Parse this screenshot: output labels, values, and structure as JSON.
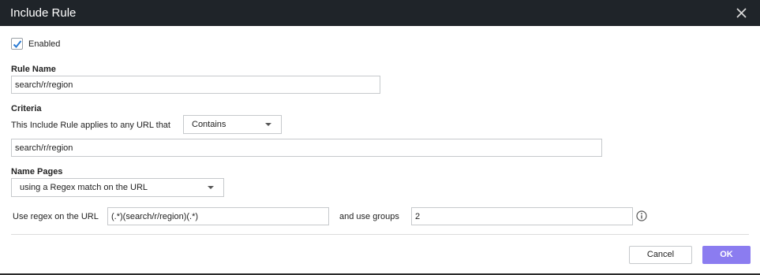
{
  "dialog": {
    "title": "Include Rule",
    "close_icon": "close-icon"
  },
  "enabled": {
    "checked": true,
    "label": "Enabled"
  },
  "rule_name": {
    "label": "Rule Name",
    "value": "search/r/region"
  },
  "criteria": {
    "label": "Criteria",
    "applies_text": "This Include Rule applies to any URL that",
    "match_type": "Contains",
    "value": "search/r/region"
  },
  "name_pages": {
    "label": "Name Pages",
    "method": "using a Regex match on the URL",
    "regex_label": "Use regex on the URL",
    "regex_value": "(.*)(search/r/region)(.*)",
    "groups_label": "and use groups",
    "groups_value": "2",
    "info_icon": "info-icon"
  },
  "buttons": {
    "cancel": "Cancel",
    "ok": "OK"
  },
  "colors": {
    "titlebar": "#1f2429",
    "accent": "#8b7cf0",
    "checkmark": "#2a7bd4"
  }
}
